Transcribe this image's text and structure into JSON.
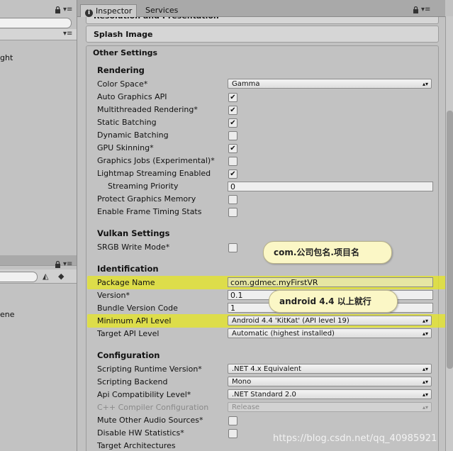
{
  "left_panel": {
    "top_item": "ght",
    "bottom_item": "ene"
  },
  "tabs": [
    {
      "label": "Inspector",
      "active": true
    },
    {
      "label": "Services",
      "active": false
    }
  ],
  "sections": {
    "partial_header": "Resolution and Presentation",
    "splash_image": "Splash Image",
    "other_settings": "Other Settings"
  },
  "rendering": {
    "title": "Rendering",
    "color_space": {
      "label": "Color Space*",
      "value": "Gamma"
    },
    "toggles": [
      {
        "label": "Auto Graphics API",
        "checked": true
      },
      {
        "label": "Multithreaded Rendering*",
        "checked": true
      },
      {
        "label": "Static Batching",
        "checked": true
      },
      {
        "label": "Dynamic Batching",
        "checked": false
      },
      {
        "label": "GPU Skinning*",
        "checked": true
      },
      {
        "label": "Graphics Jobs (Experimental)*",
        "checked": false
      },
      {
        "label": "Lightmap Streaming Enabled",
        "checked": true
      }
    ],
    "streaming_priority": {
      "label": "Streaming Priority",
      "value": "0"
    },
    "protect_memory": {
      "label": "Protect Graphics Memory",
      "checked": false
    },
    "frame_timing": {
      "label": "Enable Frame Timing Stats",
      "checked": false
    }
  },
  "vulkan": {
    "title": "Vulkan Settings",
    "srgb": {
      "label": "SRGB Write Mode*",
      "checked": false
    }
  },
  "identification": {
    "title": "Identification",
    "package_name": {
      "label": "Package Name",
      "value": "com.gdmec.myFirstVR"
    },
    "version": {
      "label": "Version*",
      "value": "0.1"
    },
    "bundle_version_code": {
      "label": "Bundle Version Code",
      "value": "1"
    },
    "min_api": {
      "label": "Minimum API Level",
      "value": "Android 4.4 'KitKat' (API level 19)"
    },
    "target_api": {
      "label": "Target API Level",
      "value": "Automatic (highest installed)"
    }
  },
  "configuration": {
    "title": "Configuration",
    "scripting_runtime": {
      "label": "Scripting Runtime Version*",
      "value": ".NET 4.x Equivalent"
    },
    "scripting_backend": {
      "label": "Scripting Backend",
      "value": "Mono"
    },
    "api_compat": {
      "label": "Api Compatibility Level*",
      "value": ".NET Standard 2.0"
    },
    "cpp_config": {
      "label": "C++ Compiler Configuration",
      "value": "Release"
    },
    "mute_audio": {
      "label": "Mute Other Audio Sources*",
      "checked": false
    },
    "disable_hw_stats": {
      "label": "Disable HW Statistics*",
      "checked": false
    },
    "target_arch": {
      "label": "Target Architectures"
    }
  },
  "annotations": {
    "callout_package": "com.公司包名.项目名",
    "callout_api": "android 4.4 以上就行"
  },
  "watermark": "https://blog.csdn.net/qq_40985921",
  "colors": {
    "highlight": "#e3e42c",
    "callout_bg": "#fbf7c6",
    "checkmark": "#111111"
  }
}
